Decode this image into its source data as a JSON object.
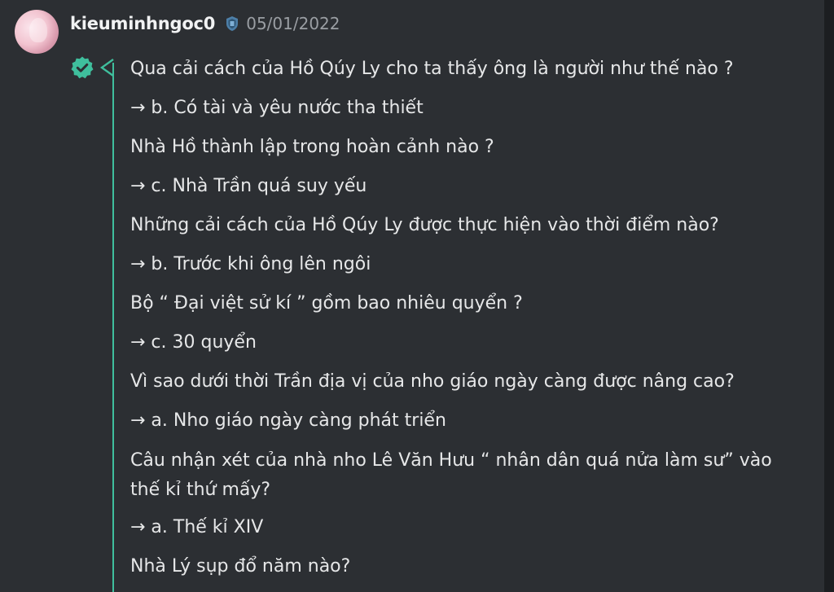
{
  "post": {
    "username": "kieuminhngoc0",
    "date": "05/01/2022",
    "rank_icon": "shield-badge-icon",
    "status_icon": "verified-check-icon",
    "accent_color": "#3fbf9d"
  },
  "lines": [
    "Qua cải cách của Hồ Qúy Ly cho ta thấy ông là người như thế nào ?",
    "→ b. Có tài và yêu nước tha thiết",
    "Nhà Hồ thành lập trong hoàn cảnh nào ?",
    "→ c. Nhà Trần quá suy yếu",
    "Những cải cách của Hồ Qúy Ly được thực hiện vào thời điểm nào?",
    "→ b. Trước khi ông lên ngôi",
    "Bộ “ Đại việt sử kí ” gồm bao nhiêu quyển ?",
    "→ c. 30 quyển",
    "Vì sao dưới thời Trần địa vị của nho giáo ngày càng được nâng cao?",
    "→ a. Nho giáo ngày càng phát triển",
    "Câu nhận xét của nhà nho Lê Văn Hưu “ nhân dân quá nửa làm sư” vào thế kỉ thứ mấy?",
    "→ a. Thế kỉ XIV",
    "Nhà Lý sụp đổ năm nào?"
  ]
}
